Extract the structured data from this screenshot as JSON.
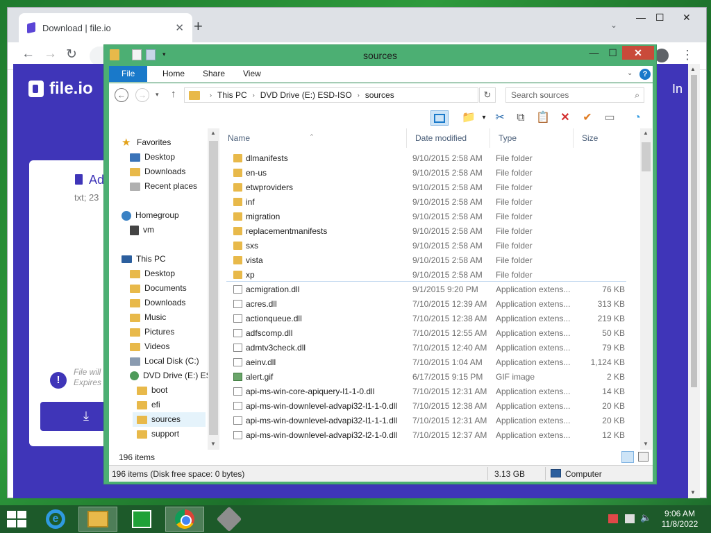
{
  "chrome": {
    "tab_title": "Download | file.io",
    "tab_close": "✕",
    "new_tab": "+",
    "tab_search": "⌄",
    "minimize": "—",
    "maximize": "☐",
    "close": "✕",
    "back": "←",
    "forward": "→",
    "reload": "↻",
    "kebab": "⋮"
  },
  "site": {
    "logo_text": "file.io",
    "login_text": "In",
    "file_name": "Ad",
    "file_meta": "txt; 23",
    "note_line1": "File will",
    "note_line2": "Expires",
    "warn_icon": "!",
    "download_icon": "⤓"
  },
  "explorer": {
    "title": "sources",
    "qa_dropdown": "▾",
    "minimize": "—",
    "maximize": "☐",
    "close": "✕",
    "ribbon": {
      "tabs": [
        "File",
        "Home",
        "Share",
        "View"
      ],
      "chevron": "⌄",
      "help": "?"
    },
    "address": {
      "back": "←",
      "forward": "→",
      "recent": "▾",
      "up": "↑",
      "crumbs": [
        "This PC",
        "DVD Drive (E:) ESD-ISO",
        "sources"
      ],
      "separator": "›",
      "dropdown": "⌄",
      "refresh": "↻",
      "search_placeholder": "Search sources",
      "search_icon": "⌕"
    },
    "commands": [
      "⊟",
      "📁",
      "▾",
      "✂",
      "⧉",
      "📋",
      "✕",
      "✔",
      "▭",
      "◔"
    ],
    "nav": {
      "favorites": "Favorites",
      "fav_items": [
        "Desktop",
        "Downloads",
        "Recent places"
      ],
      "homegroup": "Homegroup",
      "home_items": [
        "vm"
      ],
      "this_pc": "This PC",
      "pc_items": [
        "Desktop",
        "Documents",
        "Downloads",
        "Music",
        "Pictures",
        "Videos",
        "Local Disk (C:)",
        "DVD Drive (E:) ES"
      ],
      "dvd_children": [
        "boot",
        "efi",
        "sources",
        "support"
      ],
      "selected": "sources",
      "scroll_up": "▲",
      "scroll_down": "▼"
    },
    "columns": {
      "name": "Name",
      "date": "Date modified",
      "type": "Type",
      "size": "Size",
      "sort_arrow": "^"
    },
    "rows": [
      {
        "name": "dlmanifests",
        "date": "9/10/2015 2:58 AM",
        "type": "File folder",
        "size": "",
        "icon": "folder"
      },
      {
        "name": "en-us",
        "date": "9/10/2015 2:58 AM",
        "type": "File folder",
        "size": "",
        "icon": "folder"
      },
      {
        "name": "etwproviders",
        "date": "9/10/2015 2:58 AM",
        "type": "File folder",
        "size": "",
        "icon": "folder"
      },
      {
        "name": "inf",
        "date": "9/10/2015 2:58 AM",
        "type": "File folder",
        "size": "",
        "icon": "folder"
      },
      {
        "name": "migration",
        "date": "9/10/2015 2:58 AM",
        "type": "File folder",
        "size": "",
        "icon": "folder"
      },
      {
        "name": "replacementmanifests",
        "date": "9/10/2015 2:58 AM",
        "type": "File folder",
        "size": "",
        "icon": "folder"
      },
      {
        "name": "sxs",
        "date": "9/10/2015 2:58 AM",
        "type": "File folder",
        "size": "",
        "icon": "folder"
      },
      {
        "name": "vista",
        "date": "9/10/2015 2:58 AM",
        "type": "File folder",
        "size": "",
        "icon": "folder"
      },
      {
        "name": "xp",
        "date": "9/10/2015 2:58 AM",
        "type": "File folder",
        "size": "",
        "icon": "folder"
      },
      {
        "name": "acmigration.dll",
        "date": "9/1/2015 9:20 PM",
        "type": "Application extens...",
        "size": "76 KB",
        "icon": "dll"
      },
      {
        "name": "acres.dll",
        "date": "7/10/2015 12:39 AM",
        "type": "Application extens...",
        "size": "313 KB",
        "icon": "dll"
      },
      {
        "name": "actionqueue.dll",
        "date": "7/10/2015 12:38 AM",
        "type": "Application extens...",
        "size": "219 KB",
        "icon": "dll"
      },
      {
        "name": "adfscomp.dll",
        "date": "7/10/2015 12:55 AM",
        "type": "Application extens...",
        "size": "50 KB",
        "icon": "dll"
      },
      {
        "name": "admtv3check.dll",
        "date": "7/10/2015 12:40 AM",
        "type": "Application extens...",
        "size": "79 KB",
        "icon": "dll"
      },
      {
        "name": "aeinv.dll",
        "date": "7/10/2015 1:04 AM",
        "type": "Application extens...",
        "size": "1,124 KB",
        "icon": "dll"
      },
      {
        "name": "alert.gif",
        "date": "6/17/2015 9:15 PM",
        "type": "GIF image",
        "size": "2 KB",
        "icon": "gif"
      },
      {
        "name": "api-ms-win-core-apiquery-l1-1-0.dll",
        "date": "7/10/2015 12:31 AM",
        "type": "Application extens...",
        "size": "14 KB",
        "icon": "dll"
      },
      {
        "name": "api-ms-win-downlevel-advapi32-l1-1-0.dll",
        "date": "7/10/2015 12:38 AM",
        "type": "Application extens...",
        "size": "20 KB",
        "icon": "dll"
      },
      {
        "name": "api-ms-win-downlevel-advapi32-l1-1-1.dll",
        "date": "7/10/2015 12:31 AM",
        "type": "Application extens...",
        "size": "20 KB",
        "icon": "dll"
      },
      {
        "name": "api-ms-win-downlevel-advapi32-l2-1-0.dll",
        "date": "7/10/2015 12:37 AM",
        "type": "Application extens...",
        "size": "12 KB",
        "icon": "dll"
      }
    ],
    "item_count": "196 items",
    "status": {
      "text": "196 items (Disk free space: 0 bytes)",
      "size": "3.13 GB",
      "location": "Computer"
    }
  },
  "taskbar": {
    "ie_glyph": "e",
    "time": "9:06 AM",
    "date": "11/8/2022",
    "volume": "🔈"
  }
}
